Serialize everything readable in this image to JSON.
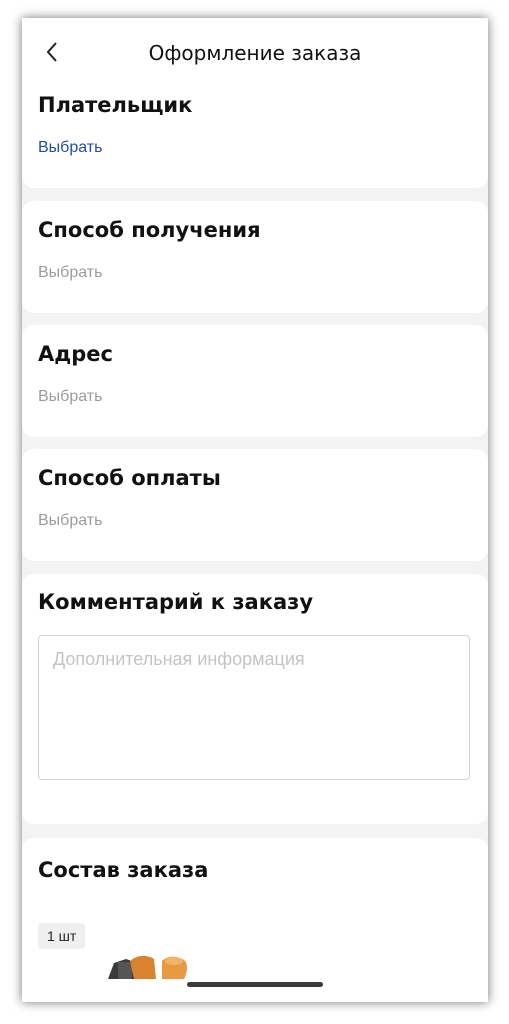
{
  "header": {
    "title": "Оформление заказа",
    "back_icon": "chevron-left-icon"
  },
  "sections": {
    "payer": {
      "title": "Плательщик",
      "action": "Выбрать"
    },
    "delivery_method": {
      "title": "Способ получения",
      "action": "Выбрать"
    },
    "address": {
      "title": "Адрес",
      "action": "Выбрать"
    },
    "payment_method": {
      "title": "Способ оплаты",
      "action": "Выбрать"
    },
    "comment": {
      "title": "Комментарий к заказу",
      "placeholder": "Дополнительная информация",
      "value": ""
    },
    "order_items": {
      "title": "Состав заказа",
      "quantity_badge": "1 шт"
    }
  },
  "colors": {
    "accent_link": "#1f4ea8",
    "muted_link": "#9c9c9c",
    "background": "#f3f3f3"
  }
}
